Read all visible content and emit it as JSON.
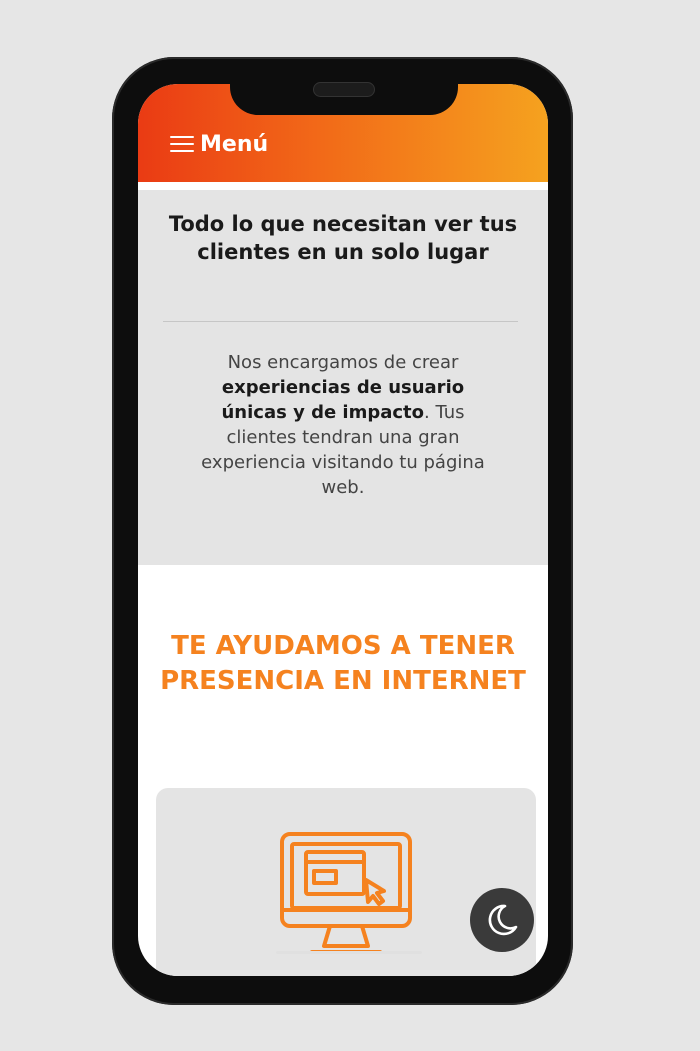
{
  "header": {
    "menu_label": "Menú",
    "background_gradient": [
      "#ea3b14",
      "#f26a18",
      "#f5a21f"
    ]
  },
  "intro": {
    "title": "Todo lo que necesitan ver tus clientes en un solo lugar",
    "text_before": "Nos encargamos de crear ",
    "text_bold": "experiencias de usuario únicas y de impacto",
    "text_after": ". Tus clientes tendran una gran experiencia visitando tu página web."
  },
  "promo": {
    "title": "TE AYUDAMOS A TENER PRESENCIA EN INTERNET",
    "accent_color": "#f5821f"
  },
  "card": {
    "icon": "web-design-monitor-icon"
  },
  "theme_toggle": {
    "icon": "moon-icon"
  }
}
